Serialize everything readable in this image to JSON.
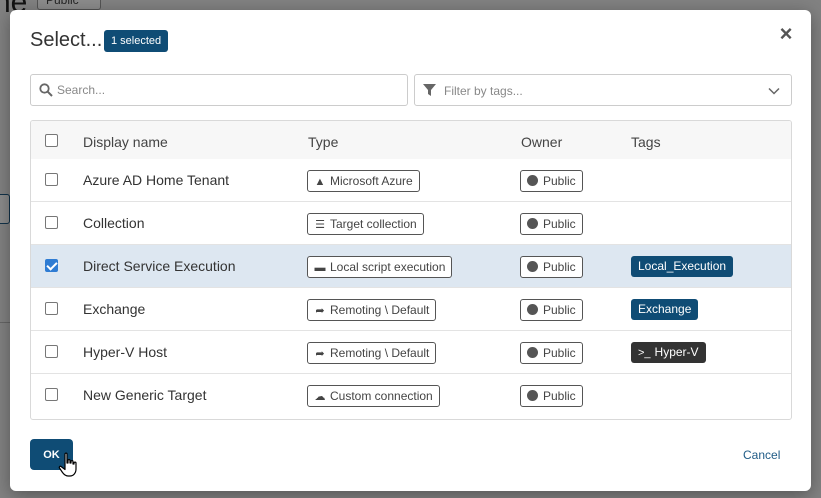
{
  "background": {
    "page_title_fragment": "ne",
    "badge_label": "Public"
  },
  "modal": {
    "title": "Select...",
    "selected_badge": "1 selected",
    "close_label": "×",
    "search_placeholder": "Search...",
    "filter_placeholder": "Filter by tags...",
    "ok_label": "OK",
    "cancel_label": "Cancel"
  },
  "table": {
    "columns": [
      "Display name",
      "Type",
      "Owner",
      "Tags"
    ],
    "rows": [
      {
        "name": "Azure AD Home Tenant",
        "type": "Microsoft Azure",
        "type_icon": "azure-icon",
        "owner": "Public",
        "tag": "",
        "checked": false
      },
      {
        "name": "Collection",
        "type": "Target collection",
        "type_icon": "layers-icon",
        "owner": "Public",
        "tag": "",
        "checked": false
      },
      {
        "name": "Direct Service Execution",
        "type": "Local script execution",
        "type_icon": "drive-icon",
        "owner": "Public",
        "tag": "Local_Execution",
        "checked": true
      },
      {
        "name": "Exchange",
        "type": "Remoting \\ Default",
        "type_icon": "share-arrow-icon",
        "owner": "Public",
        "tag": "Exchange",
        "checked": false
      },
      {
        "name": "Hyper-V Host",
        "type": "Remoting \\ Default",
        "type_icon": "share-arrow-icon",
        "owner": "Public",
        "tag": "Hyper-V",
        "tag_icon": "terminal-icon",
        "checked": false
      },
      {
        "name": "New Generic Target",
        "type": "Custom connection",
        "type_icon": "cloud-icon",
        "owner": "Public",
        "tag": "",
        "checked": false
      }
    ]
  },
  "colors": {
    "accent": "#0f4c75",
    "selected_row": "#dde7f1",
    "checkbox_checked": "#2f7cd3"
  }
}
